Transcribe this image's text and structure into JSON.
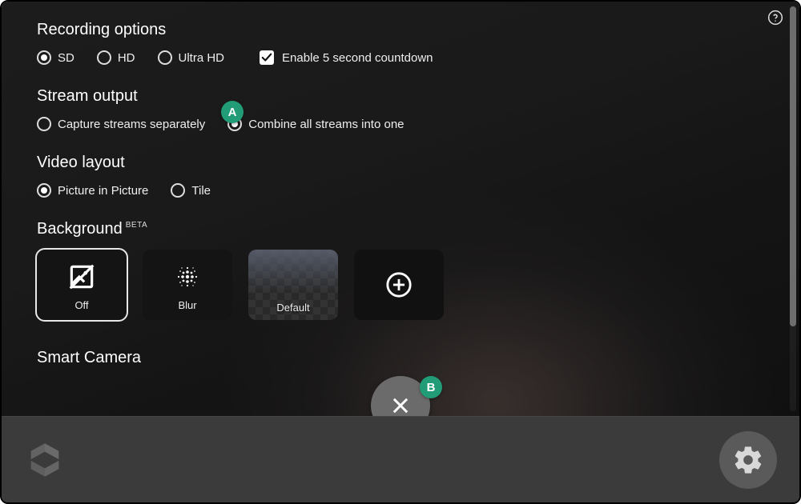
{
  "sections": {
    "recording": {
      "title": "Recording options",
      "sd": "SD",
      "hd": "HD",
      "ultra": "Ultra HD",
      "countdown": "Enable 5 second countdown"
    },
    "stream": {
      "title": "Stream output",
      "separate": "Capture streams separately",
      "combine": "Combine all streams into one"
    },
    "layout": {
      "title": "Video layout",
      "pip": "Picture in Picture",
      "tile": "Tile"
    },
    "background": {
      "title": "Background",
      "beta": "BETA",
      "off": "Off",
      "blur": "Blur",
      "default_": "Default"
    },
    "smart": {
      "title": "Smart Camera"
    }
  },
  "annotations": {
    "a": "A",
    "b": "B"
  }
}
